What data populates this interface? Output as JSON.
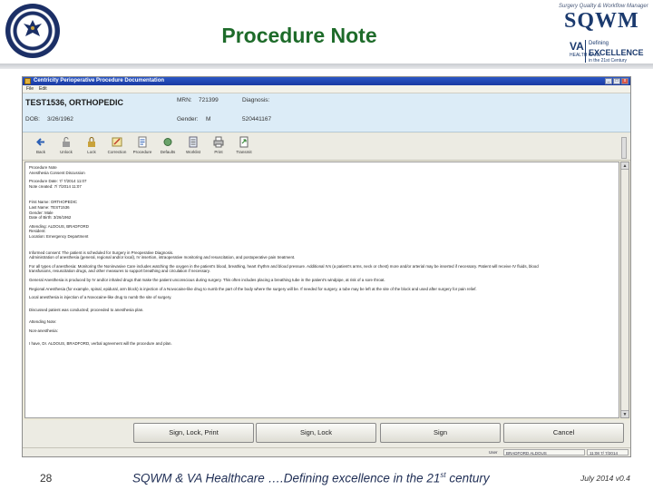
{
  "slide": {
    "title": "Procedure Note",
    "page_number": "28",
    "footer_prefix": "SQWM & VA Healthcare ….Defining excellence in the 21",
    "footer_sup": "st",
    "footer_suffix": " century",
    "date": "July 2014  v0.4"
  },
  "logo": {
    "tagline": "Surgery Quality & Workflow Manager",
    "word": "SQWM",
    "va": "VA",
    "care": "HEALTH CARE",
    "defining": "Defining",
    "excellence": "EXCELLENCE",
    "century": "in the 21st Century"
  },
  "window": {
    "title": "Centricity Perioperative Procedure Documentation",
    "controls": [
      "_",
      "□",
      "x"
    ],
    "menu": [
      "File",
      "Edit"
    ]
  },
  "patient": {
    "name": "TEST1536, ORTHOPEDIC",
    "dob_label": "DOB:",
    "dob": "3/26/1962",
    "mrn_label": "MRN:",
    "mrn": "721399",
    "gender_label": "Gender:",
    "gender": "M",
    "diagnosis_label": "Diagnosis:",
    "diagnosis_code": "520441167"
  },
  "toolbar": [
    {
      "label": "Back",
      "icon": "back-arrow-icon"
    },
    {
      "label": "Unlock",
      "icon": "unlock-icon"
    },
    {
      "label": "Lock",
      "icon": "lock-icon"
    },
    {
      "label": "Correction",
      "icon": "correction-icon"
    },
    {
      "label": "Procedure",
      "icon": "procedure-icon"
    },
    {
      "label": "Defaults",
      "icon": "defaults-icon"
    },
    {
      "label": "Worklist",
      "icon": "worklist-icon"
    },
    {
      "label": "Print",
      "icon": "print-icon"
    },
    {
      "label": "Transmit",
      "icon": "transmit-icon"
    }
  ],
  "document": {
    "lines": [
      "Procedure Note",
      "Anesthesia Consent Discussion",
      "",
      "Procedure Date: 7/ 7/2014  11:07",
      "Note created: 7/ 7/2014  11:07",
      "",
      "",
      "",
      "First Name: ORTHOPEDIC",
      "Last Name: TEST1536",
      "Gender: Male",
      "Date of Birth: 3/26/1962",
      "",
      "Attending: ALDOUS, BRADFORD",
      "Resident:",
      "Location: Emergency Department",
      "",
      "",
      "",
      "Informed consent: The patient is scheduled for Surgery in Preoperative Diagnosis.",
      "Administration of anesthesia (general, regional and/or local), IV insertion, intraoperative monitoring and resuscitation, and postoperative pain treatment.",
      "",
      "For all types of anesthesia: Monitoring the Noninvasive Care includes watching the oxygen in the patient's blood, breathing, heart rhythm and blood pressure. Additional IVs (a patient's arms, neck or chest) more and/or arterial may be inserted if necessary. Patient will receive IV fluids, blood",
      "transfusions, resuscitation drugs, and other measures to support breathing and circulation if necessary.",
      "",
      "General Anesthesia is produced by IV and/or inhaled drugs that make the patient unconscious during surgery. This often includes placing a breathing tube in the patient's windpipe, at risk of a sore throat.",
      "",
      "Regional Anesthesia (for example, spinal, epidural, arm block) is injection of a Novocaine-like drug to numb the part of the body where the surgery will be. If needed for surgery, a tube may be left at the site of the block and used after surgery for pain relief.",
      "",
      "Local anesthesia is injection of a Novocaine-like drug to numb the site of surgery.",
      "",
      "",
      "Discussed patient was conducted; proceeded to anesthesia plan.",
      "",
      "",
      "Attending Note:",
      "",
      "Non-anesthesia:",
      "",
      "",
      "I have, Dr. ALDOUS, BRADFORD, verbal agreement will the procedure and plan."
    ]
  },
  "actions": {
    "sign_lock_print": "Sign, Lock, Print",
    "sign_lock": "Sign, Lock",
    "sign": "Sign",
    "cancel": "Cancel"
  },
  "status": {
    "user_label": "User",
    "user": "BRADFORD ALDOUS",
    "timestamp": "11:08  7/ 7/2014"
  },
  "colors": {
    "title_green": "#1e6b2a",
    "banner_blue": "#dcecf7",
    "footer_navy": "#1f2e55"
  }
}
